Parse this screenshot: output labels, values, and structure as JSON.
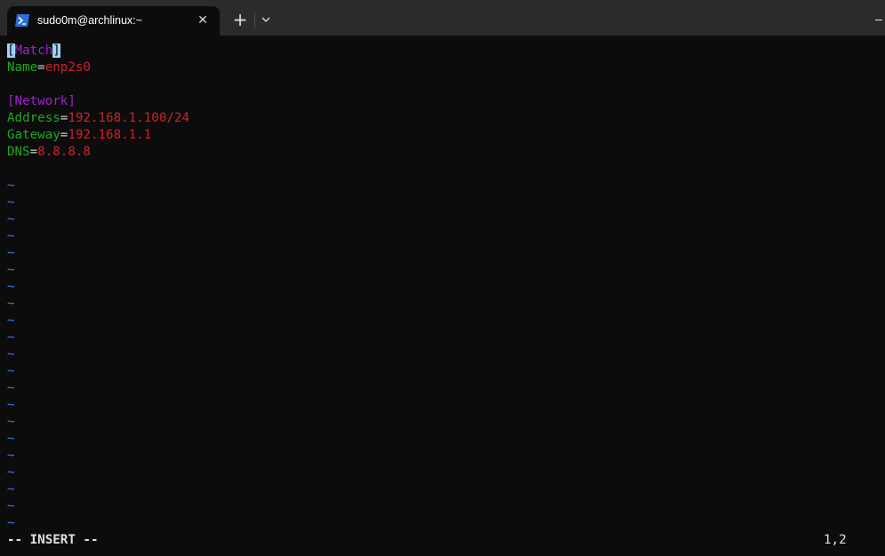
{
  "window": {
    "tab_title": "sudo0m@archlinux:~",
    "close_glyph": "✕",
    "new_tab_glyph": "+"
  },
  "editor": {
    "match_open": "[",
    "match_text": "Match",
    "match_close": "]",
    "name_key": "Name",
    "name_eq": "=",
    "name_val": "enp2s0",
    "network_section": "[Network]",
    "address_key": "Address",
    "address_eq": "=",
    "address_val": "192.168.1.100/24",
    "gateway_key": "Gateway",
    "gateway_eq": "=",
    "gateway_val": "192.168.1.1",
    "dns_key": "DNS",
    "dns_eq": "=",
    "dns_val": "8.8.8.8",
    "tilde": "~"
  },
  "status": {
    "mode": "-- INSERT --",
    "position": "1,2"
  },
  "colors": {
    "section": "#a020d0",
    "key": "#1fa81f",
    "value": "#d0212c",
    "tilde": "#3b78ff",
    "cursor": "#9fd3ff"
  }
}
